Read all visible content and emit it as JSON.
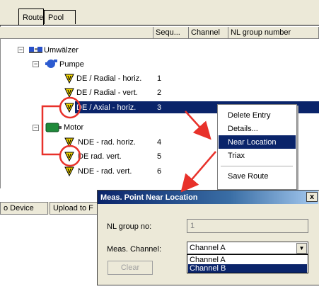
{
  "tabs": [
    {
      "label": "Route"
    },
    {
      "label": "Pool"
    }
  ],
  "columns": {
    "seq": "Sequ...",
    "channel": "Channel",
    "nl_group": "NL group number"
  },
  "tree": {
    "root": {
      "label": "Umwälzer"
    },
    "pumpe": {
      "label": "Pumpe"
    },
    "p1": {
      "label": "DE / Radial - horiz.",
      "seq": "1"
    },
    "p2": {
      "label": "DE / Radial - vert.",
      "seq": "2"
    },
    "p3": {
      "label": "DE / Axial - horiz.",
      "seq": "3"
    },
    "motor": {
      "label": "Motor"
    },
    "m1": {
      "label": "NDE - rad. horiz.",
      "seq": "4"
    },
    "m2": {
      "label": "DE rad. vert.",
      "seq": "5"
    },
    "m3": {
      "label": "NDE - rad. vert.",
      "seq": "6"
    }
  },
  "context_menu": {
    "items": [
      "Delete Entry",
      "Details...",
      "Near Location",
      "Triax",
      "Save Route"
    ],
    "highlighted": "Near Location"
  },
  "status_bar": {
    "device": "o Device",
    "upload": "Upload to F"
  },
  "dialog": {
    "title": "Meas. Point Near Location",
    "close": "x",
    "nl_group_label": "NL group no:",
    "nl_group_value": "1",
    "channel_label": "Meas. Channel:",
    "channel_value": "Channel A",
    "options": [
      "Channel A",
      "Channel B"
    ],
    "selected_option": "Channel B",
    "clear_label": "Clear"
  },
  "colors": {
    "selection": "#0a246a",
    "annotation": "#e8312a",
    "warning": "#f2d600",
    "dialog_bg": "#ece9d8"
  },
  "icons": [
    "expand-minus-icon",
    "machine-icon",
    "pump-icon",
    "motor-icon",
    "warning-triangle-icon",
    "dropdown-arrow-icon"
  ]
}
